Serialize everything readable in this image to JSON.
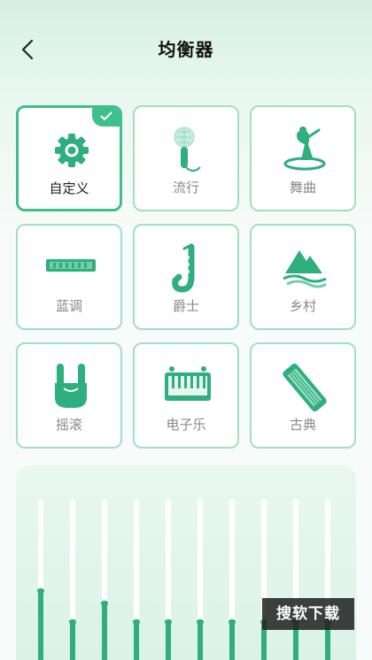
{
  "header": {
    "title": "均衡器",
    "back_icon": "chevron-left-icon"
  },
  "accent_color": "#3dc08c",
  "presets": [
    {
      "label": "自定义",
      "icon": "gear-icon",
      "selected": true
    },
    {
      "label": "流行",
      "icon": "microphone-icon",
      "selected": false
    },
    {
      "label": "舞曲",
      "icon": "dancer-icon",
      "selected": false
    },
    {
      "label": "蓝调",
      "icon": "harmonica-icon",
      "selected": false
    },
    {
      "label": "爵士",
      "icon": "saxophone-icon",
      "selected": false
    },
    {
      "label": "乡村",
      "icon": "mountain-icon",
      "selected": false
    },
    {
      "label": "摇滚",
      "icon": "rock-hand-icon",
      "selected": false
    },
    {
      "label": "电子乐",
      "icon": "keyboard-icon",
      "selected": false
    },
    {
      "label": "古典",
      "icon": "guqin-icon",
      "selected": false
    }
  ],
  "equalizer": {
    "levels": [
      0.45,
      0.27,
      0.38,
      0.27,
      0.27,
      0.27,
      0.27,
      0.27,
      0.27,
      0.27
    ]
  },
  "watermark": {
    "text": "搜软下载"
  }
}
